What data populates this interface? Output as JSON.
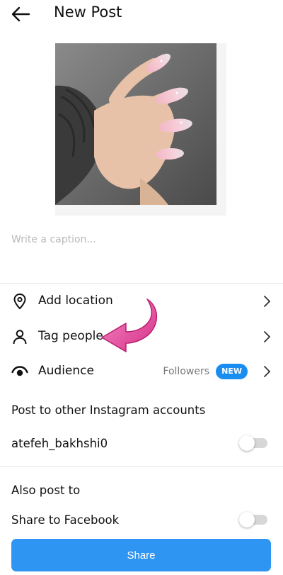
{
  "header": {
    "title": "New Post",
    "back_icon": "arrow-left-icon"
  },
  "post": {
    "image_alt": "Pink glitter almond nails",
    "caption_placeholder": "Write a caption..."
  },
  "options": [
    {
      "label": "Add location",
      "icon": "location-pin-icon"
    },
    {
      "label": "Tag people",
      "icon": "person-icon"
    },
    {
      "label": "Audience",
      "icon": "eye-icon",
      "value": "Followers",
      "badge": "NEW"
    }
  ],
  "other_accounts": {
    "title": "Post to other Instagram accounts",
    "account_name": "atefeh_bakhshi0",
    "toggle_on": false
  },
  "also_post": {
    "title": "Also post to",
    "facebook_label": "Share to Facebook",
    "toggle_on": false
  },
  "share_button": {
    "label": "Share"
  },
  "colors": {
    "accent": "#2f95f2",
    "badge": "#1a8ef0",
    "annotation_arrow": "#e8409a"
  }
}
